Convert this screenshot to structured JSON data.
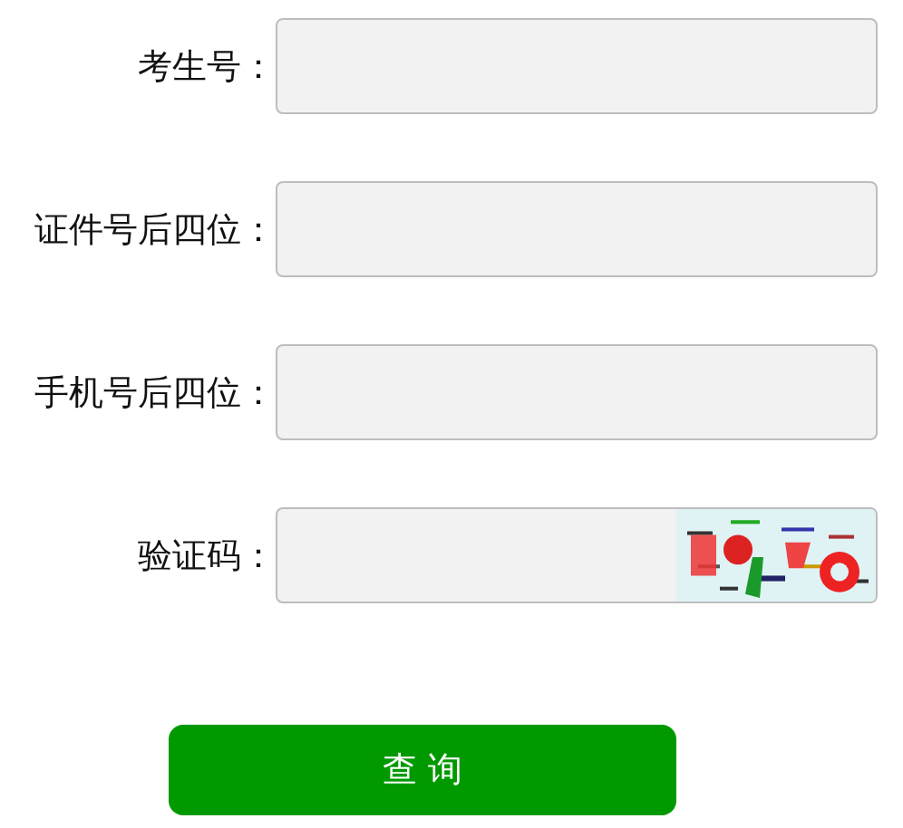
{
  "fields": [
    {
      "label": "考生号：",
      "kind": "text"
    },
    {
      "label": "证件号后四位：",
      "kind": "text"
    },
    {
      "label": "手机号后四位：",
      "kind": "text"
    },
    {
      "label": "验证码：",
      "kind": "captcha"
    }
  ],
  "submit_button": "查 询"
}
